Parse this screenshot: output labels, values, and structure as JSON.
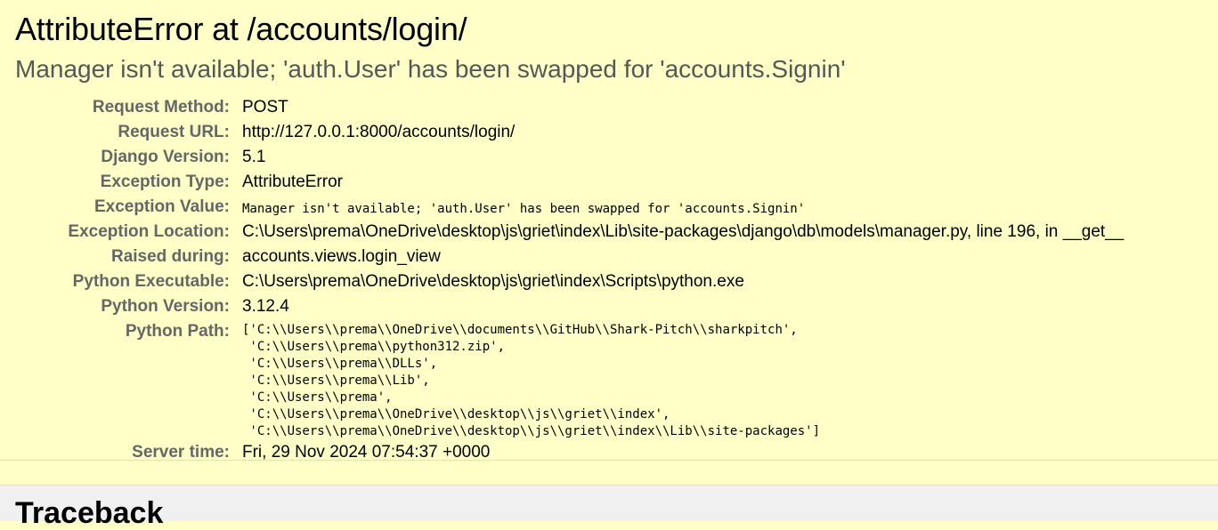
{
  "summary": {
    "title": "AttributeError at /accounts/login/",
    "subtitle": "Manager isn't available; 'auth.User' has been swapped for 'accounts.Signin'",
    "rows": {
      "request_method": {
        "label": "Request Method:",
        "value": "POST"
      },
      "request_url": {
        "label": "Request URL:",
        "value": "http://127.0.0.1:8000/accounts/login/"
      },
      "django_version": {
        "label": "Django Version:",
        "value": "5.1"
      },
      "exception_type": {
        "label": "Exception Type:",
        "value": "AttributeError"
      },
      "exception_value": {
        "label": "Exception Value:",
        "value": "Manager isn't available; 'auth.User' has been swapped for 'accounts.Signin'"
      },
      "exception_location": {
        "label": "Exception Location:",
        "value": "C:\\Users\\prema\\OneDrive\\desktop\\js\\griet\\index\\Lib\\site-packages\\django\\db\\models\\manager.py, line 196, in __get__"
      },
      "raised_during": {
        "label": "Raised during:",
        "value": "accounts.views.login_view"
      },
      "python_executable": {
        "label": "Python Executable:",
        "value": "C:\\Users\\prema\\OneDrive\\desktop\\js\\griet\\index\\Scripts\\python.exe"
      },
      "python_version": {
        "label": "Python Version:",
        "value": "3.12.4"
      },
      "python_path": {
        "label": "Python Path:",
        "value": "['C:\\\\Users\\\\prema\\\\OneDrive\\\\documents\\\\GitHub\\\\Shark-Pitch\\\\sharkpitch',\n 'C:\\\\Users\\\\prema\\\\python312.zip',\n 'C:\\\\Users\\\\prema\\\\DLLs',\n 'C:\\\\Users\\\\prema\\\\Lib',\n 'C:\\\\Users\\\\prema',\n 'C:\\\\Users\\\\prema\\\\OneDrive\\\\desktop\\\\js\\\\griet\\\\index',\n 'C:\\\\Users\\\\prema\\\\OneDrive\\\\desktop\\\\js\\\\griet\\\\index\\\\Lib\\\\site-packages']"
      },
      "server_time": {
        "label": "Server time:",
        "value": "Fri, 29 Nov 2024 07:54:37 +0000"
      }
    }
  },
  "traceback": {
    "heading": "Traceback"
  }
}
